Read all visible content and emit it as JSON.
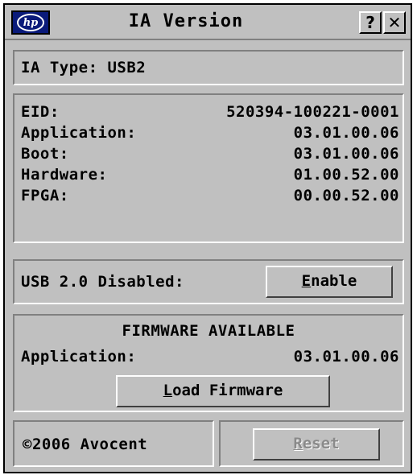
{
  "window": {
    "title": "IA Version",
    "help_label": "?",
    "close_label": "✕",
    "logo_text": "hp"
  },
  "ia_type": {
    "text": "IA Type: USB2"
  },
  "versions": [
    {
      "label": "EID:",
      "value": "520394-100221-0001"
    },
    {
      "label": "Application:",
      "value": "03.01.00.06"
    },
    {
      "label": "Boot:",
      "value": "03.01.00.06"
    },
    {
      "label": "Hardware:",
      "value": "01.00.52.00"
    },
    {
      "label": "FPGA:",
      "value": "00.00.52.00"
    }
  ],
  "usb": {
    "status": "USB 2.0 Disabled:",
    "enable_underline": "E",
    "enable_rest": "nable"
  },
  "firmware": {
    "heading": "FIRMWARE AVAILABLE",
    "app_label": "Application:",
    "app_value": "03.01.00.06",
    "load_underline": "L",
    "load_rest": "oad Firmware"
  },
  "footer": {
    "copyright": "©2006 Avocent",
    "reset_underline": "R",
    "reset_rest": "eset"
  }
}
